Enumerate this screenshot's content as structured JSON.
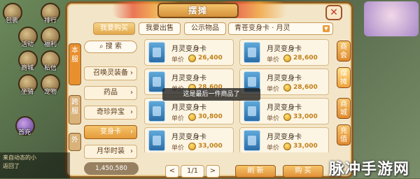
{
  "hud_left": [
    {
      "label": "包裹"
    },
    {
      "label": "排行"
    },
    {
      "label": "活动"
    },
    {
      "label": "福利"
    },
    {
      "label": "商城"
    },
    {
      "label": "私信"
    },
    {
      "label": "坐骑"
    },
    {
      "label": "宠物"
    },
    {
      "label": "首充"
    }
  ],
  "title": "摆摊",
  "close_label": "✕",
  "top_tabs": [
    "我要购买",
    "我要出售",
    "公示物品"
  ],
  "filter": "青苍变身卡 · 月灵",
  "side_vtabs": [
    "本服",
    "跨服",
    "外"
  ],
  "search": {
    "label": "搜 索"
  },
  "categories": [
    {
      "label": "召唤灵装备"
    },
    {
      "label": "药品"
    },
    {
      "label": "奇珍异宝"
    },
    {
      "label": "变身卡"
    },
    {
      "label": "月华时装"
    }
  ],
  "price_label": "单价",
  "items": [
    {
      "name": "月灵变身卡",
      "price": "26,400"
    },
    {
      "name": "月灵变身卡",
      "price": "28,600"
    },
    {
      "name": "月灵变身卡",
      "price": "28,600"
    },
    {
      "name": "月灵变身卡",
      "price": "28,600"
    },
    {
      "name": "月灵变身卡",
      "price": "30,800"
    },
    {
      "name": "月灵变身卡",
      "price": "33,000"
    },
    {
      "name": "月灵变身卡",
      "price": "33,000"
    },
    {
      "name": "月灵变身卡",
      "price": "33,000"
    }
  ],
  "toast": "这是最后一件商品了",
  "pager": {
    "prev": "<",
    "page": "1/1",
    "next": ">"
  },
  "actions": {
    "buy": "购 买",
    "refresh": "刷 新"
  },
  "right_vtabs": [
    "商会",
    "摆摊",
    "商城",
    "充值"
  ],
  "chat_lines": [
    "来自动态的小",
    "返回了"
  ],
  "currency": "1,450,580",
  "watermark": "脉冲手游网",
  "colors": {
    "panel": "#f3e6c8",
    "accent": "#e49a3a",
    "price": "#c0801a"
  }
}
